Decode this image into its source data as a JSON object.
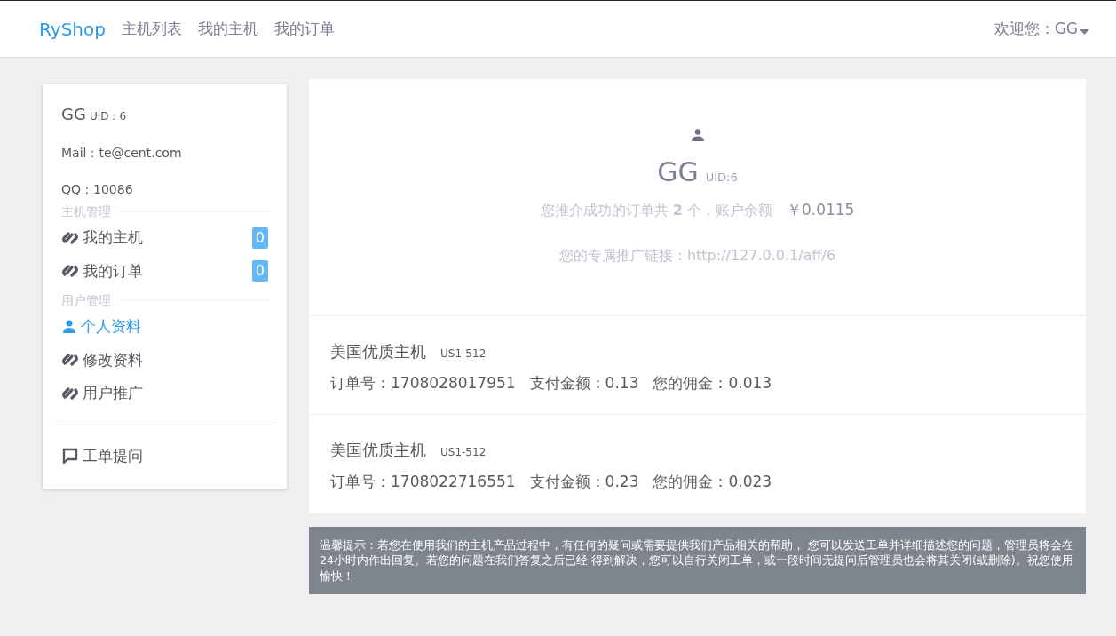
{
  "navbar": {
    "brand": "RyShop",
    "links": [
      {
        "label": "主机列表"
      },
      {
        "label": "我的主机"
      },
      {
        "label": "我的订单"
      }
    ],
    "user_menu": "欢迎您：GG"
  },
  "sidebar": {
    "name": "GG",
    "uid": "UID：6",
    "mail": "Mail：te@cent.com",
    "qq": "QQ：10086",
    "sections": [
      {
        "title": "主机管理",
        "items": [
          {
            "kind": "link",
            "label": "我的主机",
            "badge": "0",
            "selected": false
          },
          {
            "kind": "link",
            "label": "我的订单",
            "badge": "0",
            "selected": false
          }
        ]
      },
      {
        "title": "用户管理",
        "items": [
          {
            "kind": "user",
            "label": "个人资料",
            "selected": true
          },
          {
            "kind": "link",
            "label": "修改资料",
            "selected": false
          },
          {
            "kind": "link",
            "label": "用户推广",
            "selected": false
          }
        ]
      }
    ],
    "footer_items": [
      {
        "kind": "chat",
        "label": "工单提问",
        "selected": false
      }
    ]
  },
  "profile": {
    "name": "GG",
    "uid": "UID:6",
    "summary": "您推介成功的订单共 **2** 个，账户余额",
    "balance": "￥0.0115",
    "link": "您的专属推广链接：http://127.0.0.1/aff/6"
  },
  "orders": [
    {
      "title": "美国优质主机",
      "code": "US1-512",
      "order_no": "订单号：1708028017951",
      "amount": "支付金额：0.13",
      "commission": "您的佣金：0.013"
    },
    {
      "title": "美国优质主机",
      "code": "US1-512",
      "order_no": "订单号：1708022716551",
      "amount": "支付金额：0.23",
      "commission": "您的佣金：0.023"
    }
  ],
  "notice": "温馨提示：若您在使用我们的主机产品过程中，有任何的疑问或需要提供我们产品相关的帮助， 您可以发送工单并详细描述您的问题，管理员将会在24小时内作出回复。若您的问题在我们答复之后已经 得到解决，您可以自行关闭工单，或一段时间无提问后管理员也会将其关闭(或删除)。祝您使用愉快！"
}
